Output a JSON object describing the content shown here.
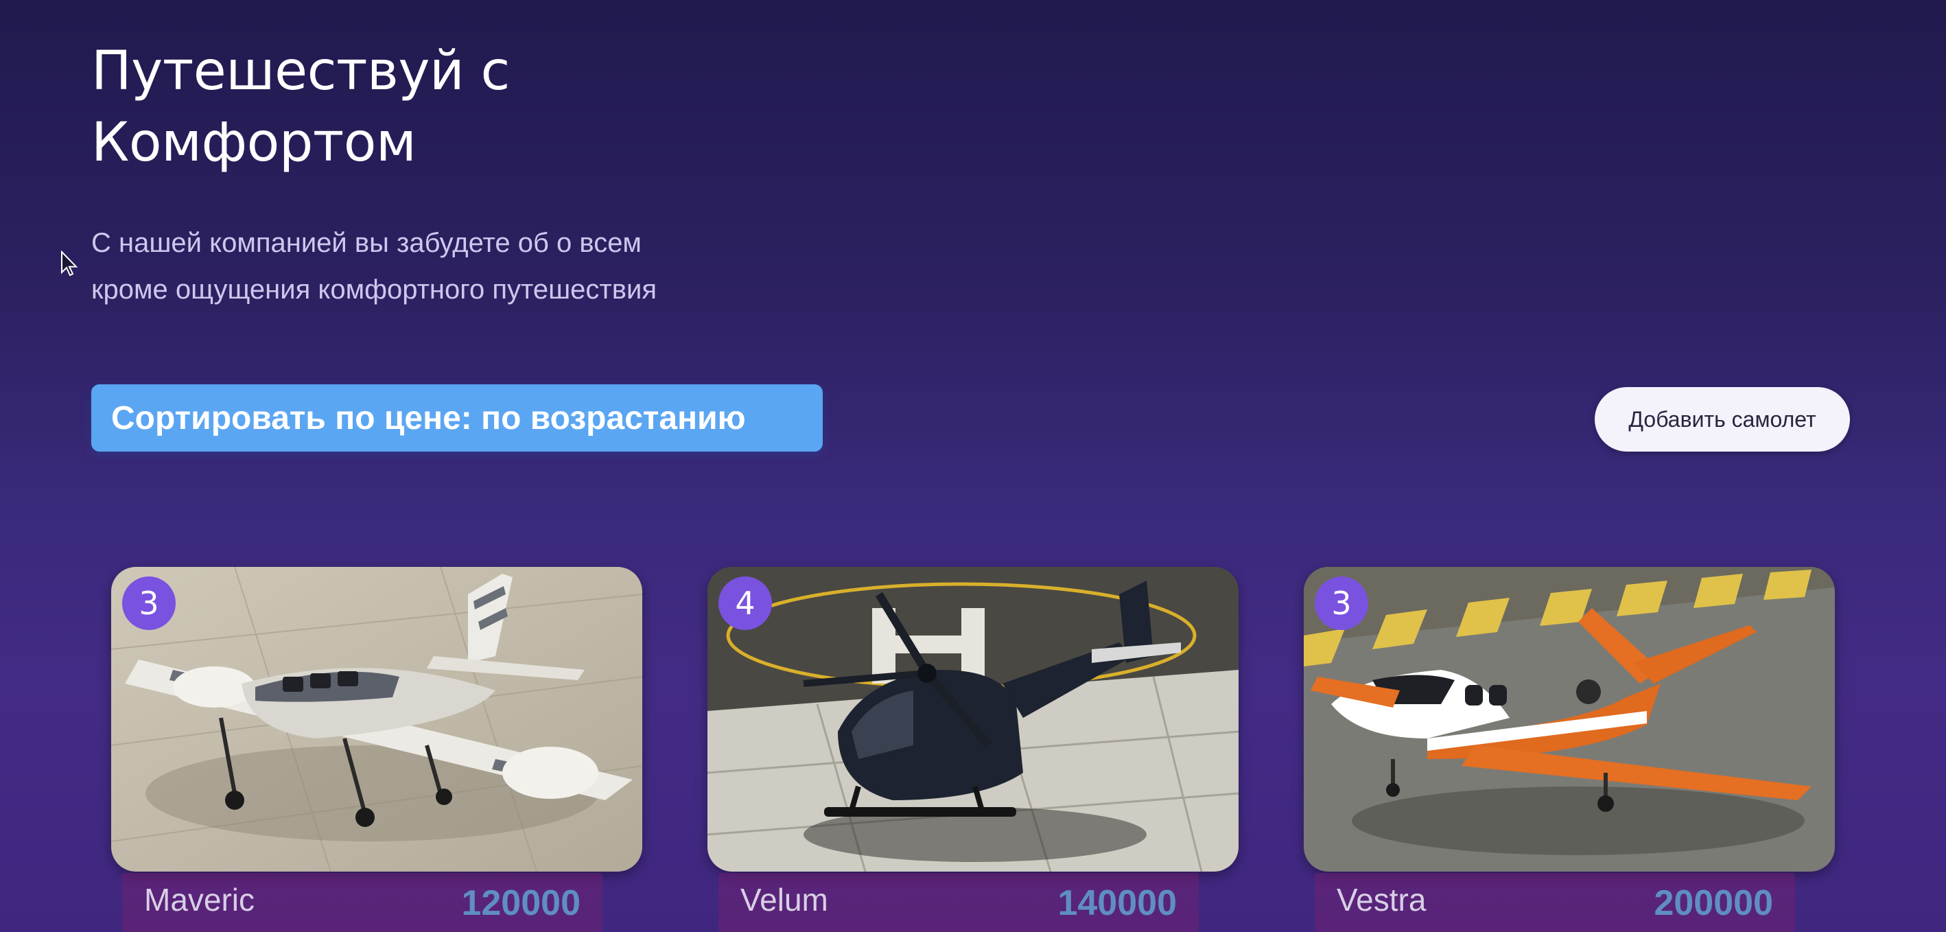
{
  "hero": {
    "title_line1": "Путешествуй с",
    "title_line2": "Комфортом",
    "subtitle_line1": "С нашей компанией вы забудете об о всем",
    "subtitle_line2": "кроме ощущения комфортного путешествия"
  },
  "controls": {
    "sort_label": "Сортировать по цене: по возрастанию",
    "add_label": "Добавить самолет"
  },
  "planes": [
    {
      "name": "Maveric",
      "price": "120000",
      "seats": "3",
      "icon": "twin-prop-plane-image"
    },
    {
      "name": "Velum",
      "price": "140000",
      "seats": "4",
      "icon": "helicopter-image"
    },
    {
      "name": "Vestra",
      "price": "200000",
      "seats": "3",
      "icon": "orange-jet-image"
    }
  ],
  "colors": {
    "background_top": "#201a4e",
    "background_bottom": "#432b85",
    "sort_button": "#5ba6f2",
    "add_button": "#f4f2fb",
    "badge": "#7a52e0",
    "price": "#5f8ec4",
    "footer": "#6b2a6e"
  }
}
